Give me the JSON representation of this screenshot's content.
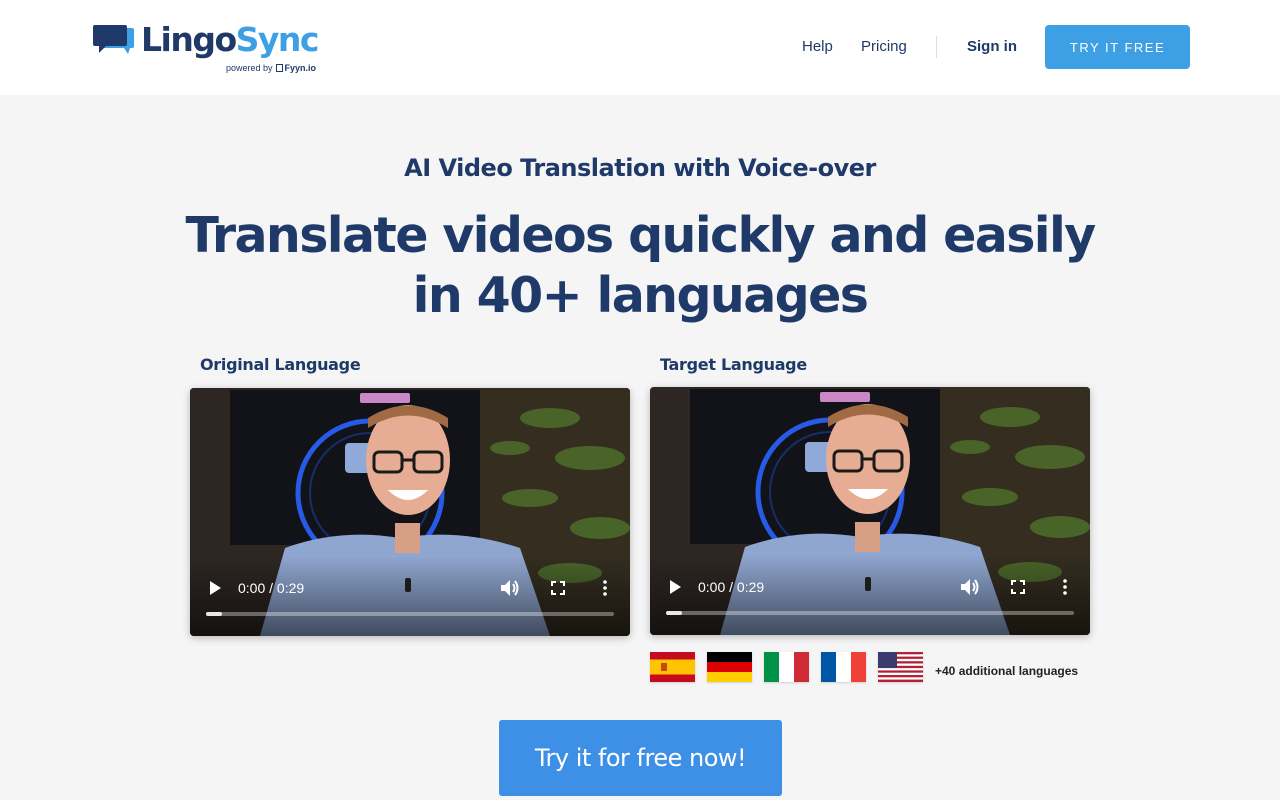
{
  "header": {
    "logo": {
      "word_part1": "Lingo",
      "word_part2": "Sync",
      "powered_prefix": "powered by",
      "powered_brand": "Fyyn.io"
    },
    "nav": {
      "help": "Help",
      "pricing": "Pricing",
      "sign_in": "Sign in",
      "try_free": "TRY IT FREE"
    }
  },
  "hero": {
    "subtitle": "AI Video Translation with Voice-over",
    "headline": "Translate videos quickly and easily in 40+ languages"
  },
  "videos": {
    "original": {
      "label": "Original Language",
      "time": "0:00 / 0:29",
      "progress": 0.04
    },
    "target": {
      "label": "Target Language",
      "time": "0:00 / 0:29",
      "progress": 0.04
    }
  },
  "languages": {
    "flags": [
      "spain-flag",
      "germany-flag",
      "italy-flag",
      "france-flag",
      "usa-flag"
    ],
    "additional": "+40 additional languages"
  },
  "cta": {
    "label": "Try it for free now!"
  },
  "colors": {
    "navy": "#1f3a68",
    "brand_blue": "#3ea0e4",
    "cta_blue": "#3e8fe6",
    "background": "#f5f5f6"
  }
}
